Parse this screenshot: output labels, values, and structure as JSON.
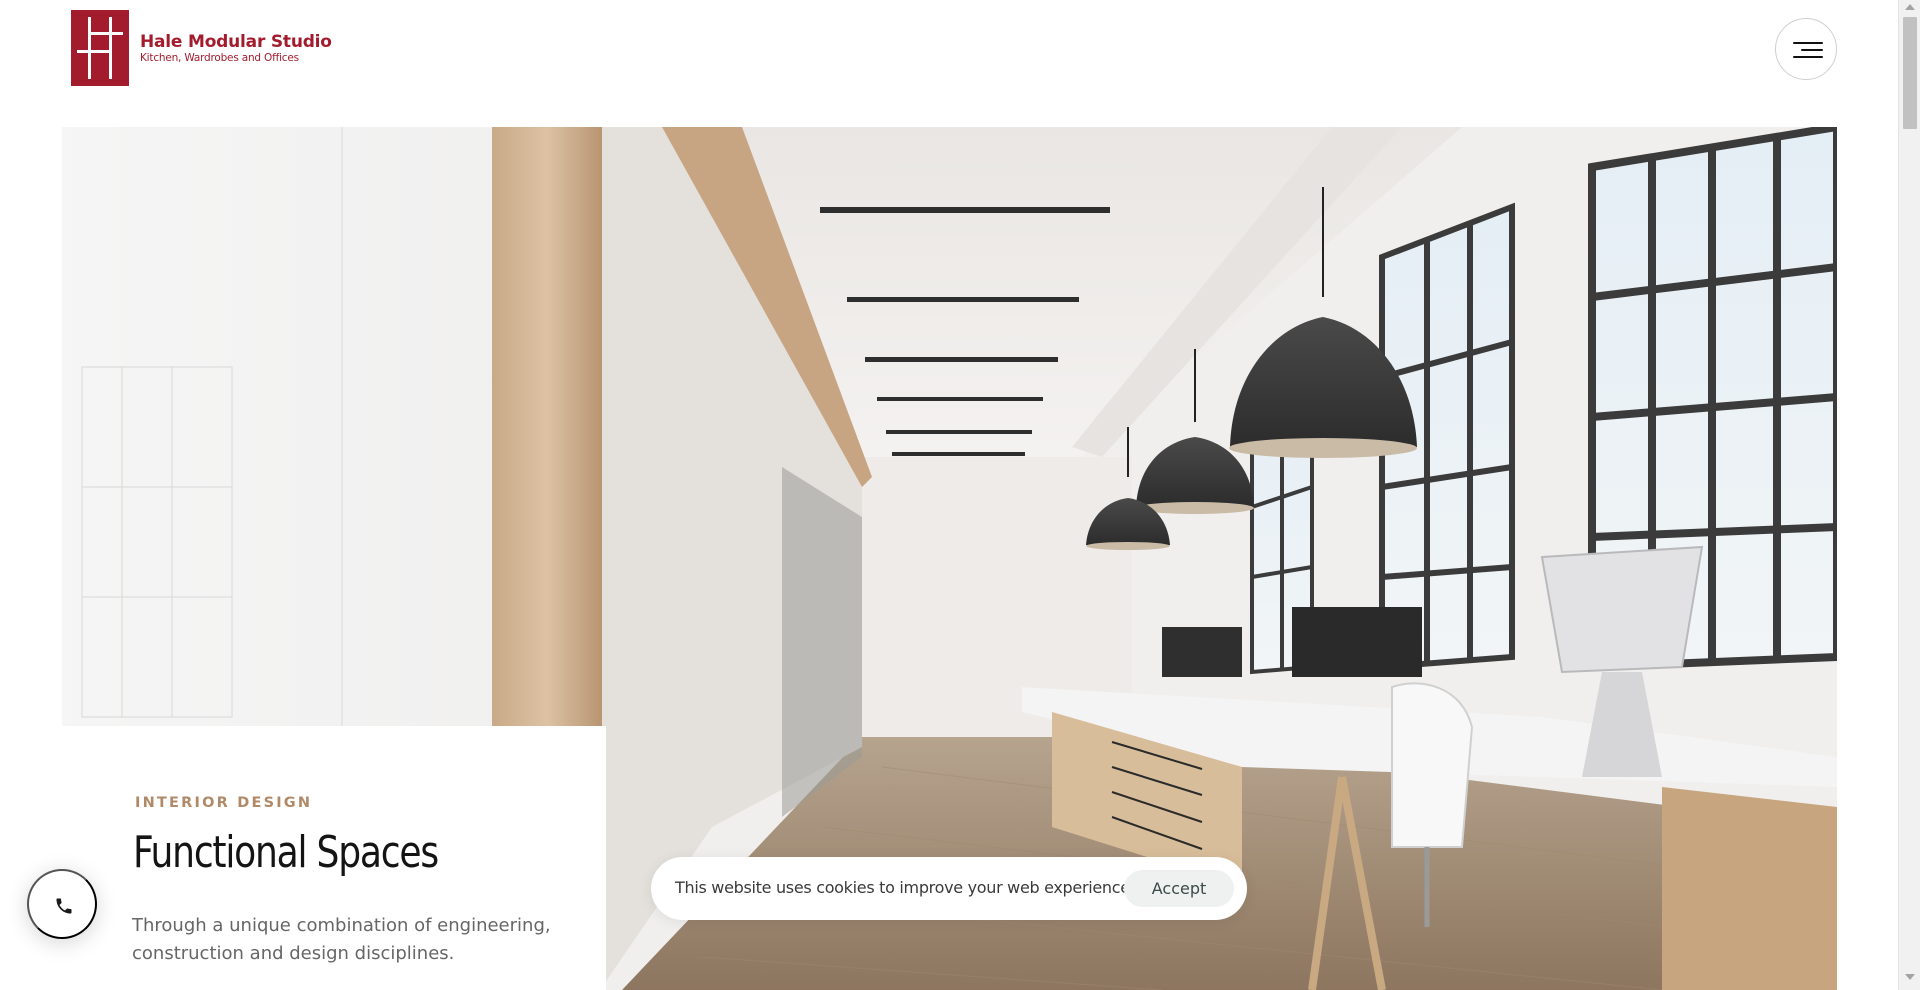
{
  "header": {
    "logo_name": "Hale Modular Studio",
    "logo_tagline": "Kitchen, Wardrobes and Offices",
    "logo_icon": "hale-monogram-logo",
    "menu_icon": "hamburger-menu-icon"
  },
  "hero": {
    "image_subject": "modern-open-office-interior",
    "eyebrow": "INTERIOR DESIGN",
    "headline": "Functional Spaces",
    "description": "Through a unique combination of engineering, construction and design disciplines."
  },
  "floating": {
    "phone_icon": "phone-icon"
  },
  "cookie": {
    "message": "This website uses cookies to improve your web experience.",
    "accept_label": "Accept"
  },
  "colors": {
    "brand": "#a31c2e",
    "accent": "#b08a68",
    "headline": "#141414",
    "cookie_button_bg": "#eef1f0"
  }
}
